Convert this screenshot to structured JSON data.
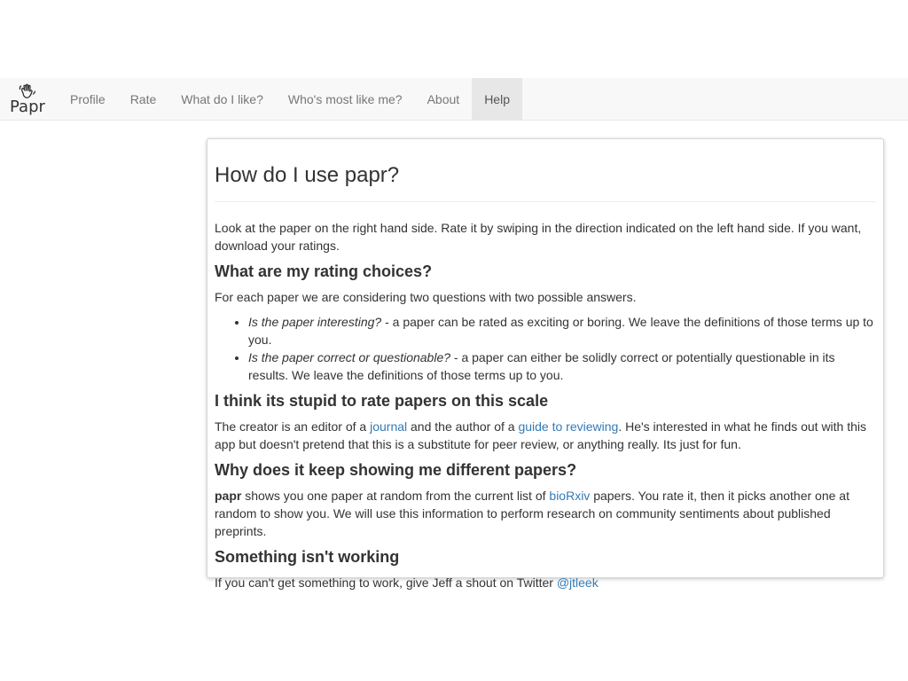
{
  "navbar": {
    "brand": "Papr",
    "items": [
      "Profile",
      "Rate",
      "What do I like?",
      "Who's most like me?",
      "About",
      "Help"
    ],
    "active": "Help"
  },
  "help": {
    "title": "How do I use papr?",
    "intro": "Look at the paper on the right hand side. Rate it by swiping in the direction indicated on the left hand side. If you want, download your ratings.",
    "choices": {
      "heading": "What are my rating choices?",
      "intro": "For each paper we are considering two questions with two possible answers.",
      "items": [
        {
          "question": "Is the paper interesting?",
          "text": " - a paper can be rated as exciting or boring. We leave the definitions of those terms up to you."
        },
        {
          "question": "Is the paper correct or questionable?",
          "text": " - a paper can either be solidly correct or potentially questionable in its results. We leave the definitions of those terms up to you."
        }
      ]
    },
    "stupid": {
      "heading": "I think its stupid to rate papers on this scale",
      "part1": "The creator is an editor of a ",
      "link1": "journal",
      "part2": " and the author of a ",
      "link2": "guide to reviewing",
      "part3": ". He's interested in what he finds out with this app but doesn't pretend that this is a substitute for peer review, or anything really. Its just for fun."
    },
    "different": {
      "heading": "Why does it keep showing me different papers?",
      "bold": "papr",
      "part1": " shows you one paper at random from the current list of ",
      "link": "bioRxiv",
      "part2": " papers. You rate it, then it picks another one at random to show you. We will use this information to perform research on community sentiments about published preprints."
    },
    "broken": {
      "heading": "Something isn't working",
      "text": "If you can't get something to work, give Jeff a shout on Twitter ",
      "link": "@jtleek"
    }
  },
  "colors": {
    "link": "#337ab7",
    "navbar_bg": "#f8f8f8",
    "nav_active_bg": "#e7e7e7",
    "nav_text": "#777777"
  },
  "icons": {
    "brand": "waving-hand-icon"
  }
}
